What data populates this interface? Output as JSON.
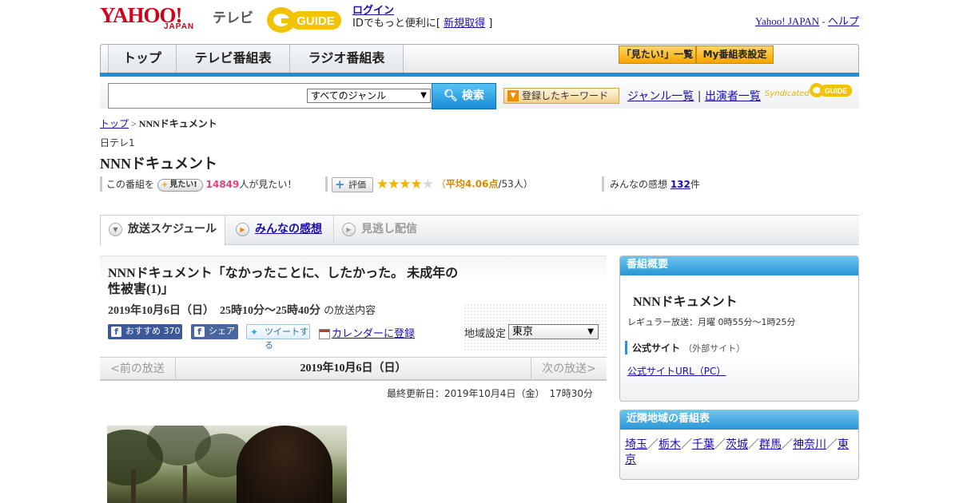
{
  "header": {
    "logo": "YAHOO!",
    "logo_sub": "JAPAN",
    "service": "テレビ",
    "gguide": "G-GUIDE",
    "login": "ログイン",
    "login_text_before": "IDでもっと便利に[ ",
    "register": "新規取得",
    "login_text_after": " ]",
    "yahoo_japan": "Yahoo! JAPAN",
    "separator": " - ",
    "help": "ヘルプ"
  },
  "nav": {
    "tabs": [
      "トップ",
      "テレビ番組表",
      "ラジオ番組表"
    ],
    "want_list": "「見たい!」一覧",
    "my_schedule": "My番組表設定"
  },
  "search": {
    "placeholder": "",
    "genre": "すべてのジャンル",
    "button": "検索",
    "keyword_button": "登録したキーワード",
    "genre_list": "ジャンル一覧",
    "divider": " | ",
    "performer_list": "出演者一覧",
    "syndicated": "Syndicated",
    "syndicated_logo": "G-GUIDE"
  },
  "breadcrumb": {
    "top": "トップ",
    "sep": " > ",
    "current": "NNNドキュメント"
  },
  "program": {
    "channel": "日テレ1",
    "title": "NNNドキュメント",
    "want_prefix": "この番組を",
    "want_button": "見たい!",
    "want_count": "14849",
    "want_suffix": "人が見たい！",
    "eval_button": "評価",
    "rating": 4.06,
    "stars_on": "★★★★",
    "stars_off": "★",
    "avg_open": "（",
    "avg_text": "平均4.06点",
    "avg_count": "/53人）",
    "impressions_prefix": "みんなの感想 ",
    "impressions_count": "132",
    "impressions_suffix": "件"
  },
  "sections": {
    "schedule": "放送スケジュール",
    "impressions": "みんなの感想",
    "streaming": "見逃し配信"
  },
  "episode": {
    "title": "NNNドキュメント「なかったことに、したかった。 未成年の性被害(1)」",
    "date": "2019年10月6日（日）　25時10分～25時40分",
    "date_suffix": "の放送内容",
    "fb_recommend": "おすすめ 370",
    "fb_share": "シェア",
    "tweet": "ツイートする",
    "calendar": "カレンダーに登録",
    "region_label": "地域設定",
    "region": "東京",
    "prev": "<前の放送",
    "pager_date": "2019年10月6日（日）",
    "next": "次の放送>",
    "updated": "最終更新日：2019年10月4日（金）　17時30分"
  },
  "panel_overview": {
    "heading": "番組概要",
    "name": "NNNドキュメント",
    "regular": "レギュラー放送：月曜 0時55分～1時25分",
    "official": "公式サイト",
    "official_note": "（外部サイト）",
    "official_url": "公式サイトURL（PC）"
  },
  "panel_nearby": {
    "heading": "近隣地域の番組表",
    "regions": [
      "埼玉",
      "栃木",
      "千葉",
      "茨城",
      "群馬",
      "神奈川",
      "東京"
    ],
    "sep": "／"
  },
  "colors": {
    "brand_red": "#d0021b",
    "accent_blue": "#1f8ed9",
    "want_pink": "#e0447c",
    "star": "#f0b400"
  }
}
